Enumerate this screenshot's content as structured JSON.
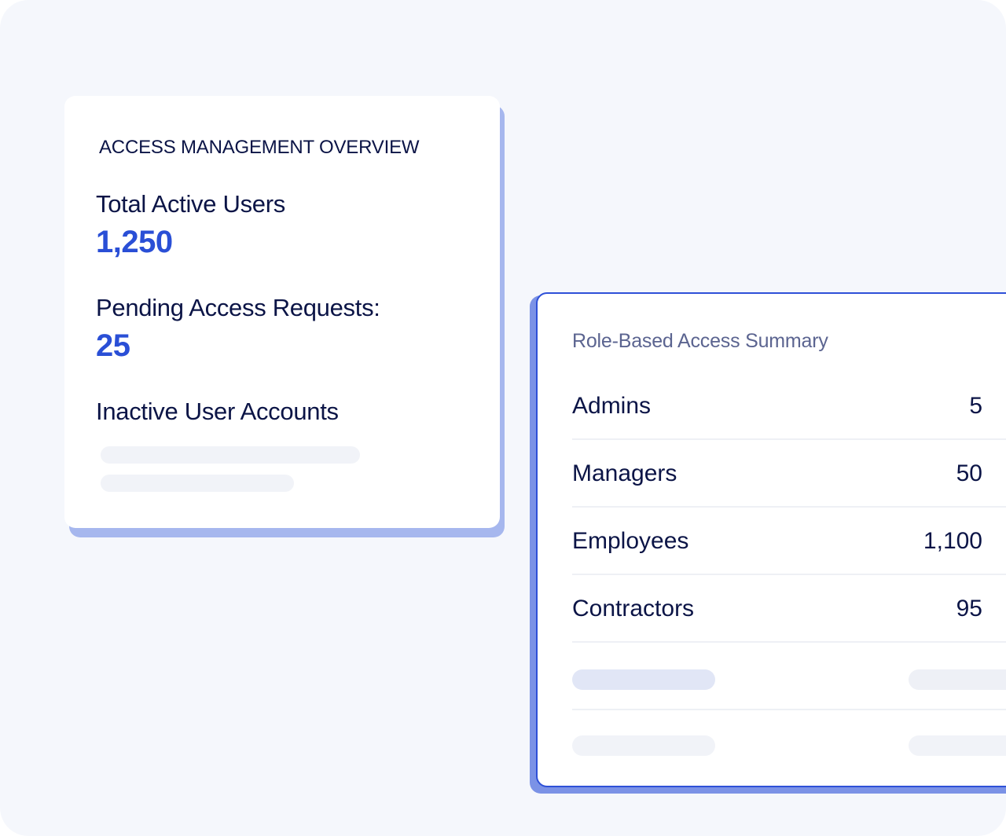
{
  "overview": {
    "title": "ACCESS MANAGEMENT OVERVIEW",
    "total_active_users_label": "Total Active Users",
    "total_active_users_value": "1,250",
    "pending_requests_label": "Pending Access Requests:",
    "pending_requests_value": "25",
    "inactive_accounts_label": "Inactive User Accounts"
  },
  "roles": {
    "title": "Role-Based Access Summary",
    "items": [
      {
        "name": "Admins",
        "count": "5"
      },
      {
        "name": "Managers",
        "count": "50"
      },
      {
        "name": "Employees",
        "count": "1,100"
      },
      {
        "name": "Contractors",
        "count": "95"
      }
    ]
  },
  "colors": {
    "background": "#f5f7fc",
    "primary_text": "#0b1446",
    "accent": "#2a4fd6",
    "card_shadow": "#a6b7ee",
    "card_border": "#2e50d8"
  }
}
